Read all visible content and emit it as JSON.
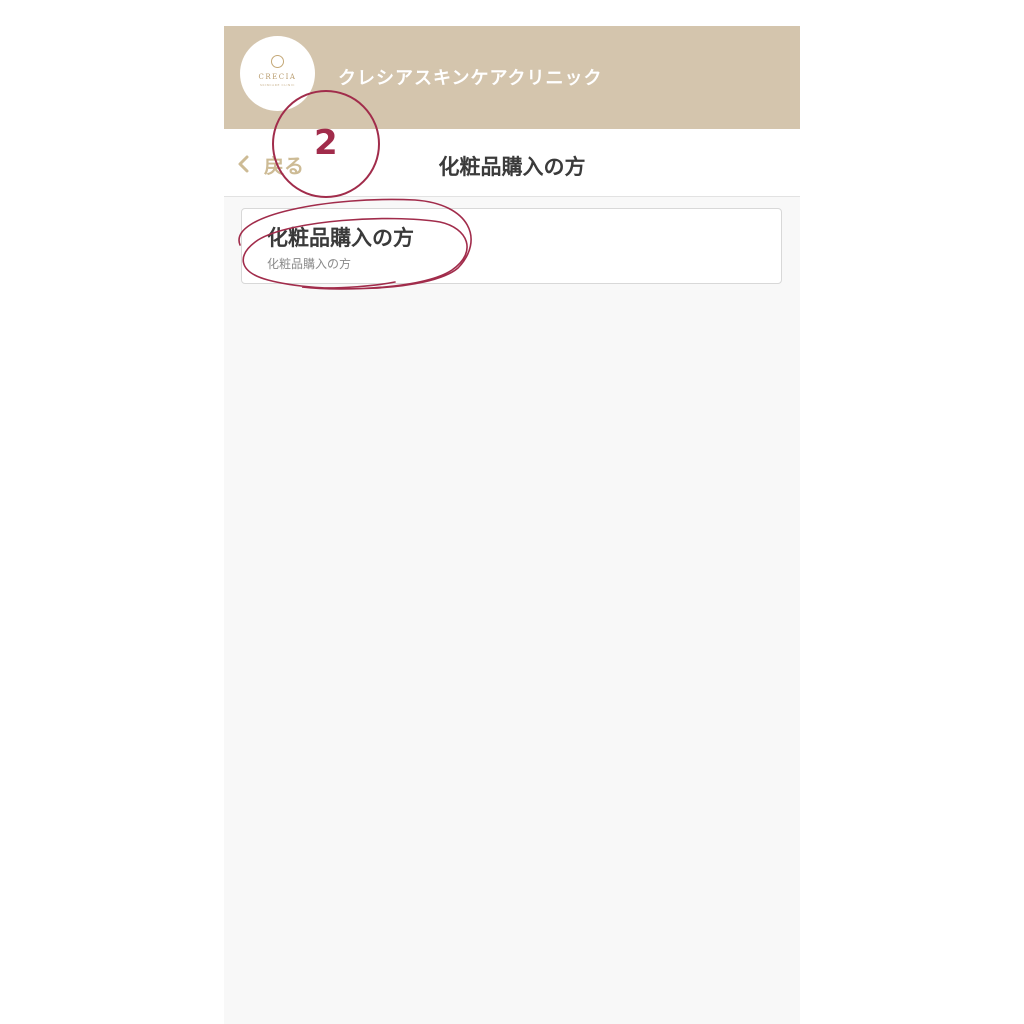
{
  "header": {
    "clinic_name": "クレシアスキンケアクリニック",
    "logo_text": "CRECIA",
    "logo_subtext": "SKINCARE CLINIC"
  },
  "nav": {
    "back_label": "戻る",
    "title": "化粧品購入の方"
  },
  "menu_item": {
    "title": "化粧品購入の方",
    "subtitle": "化粧品購入の方"
  },
  "annotation": {
    "step_number": "2"
  },
  "colors": {
    "header_bg": "#d4c5ad",
    "accent_gold": "#cdbb95",
    "annotation": "#a12c4b",
    "page_bg": "#f8f8f8"
  }
}
